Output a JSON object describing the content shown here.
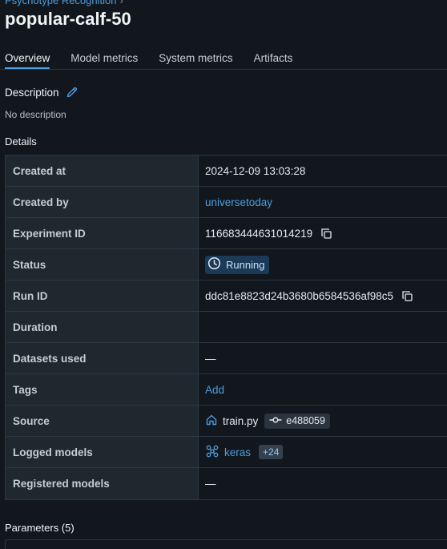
{
  "breadcrumb": {
    "experiment": "Psychotype Recognition",
    "chevron": "›"
  },
  "page_title": "popular-calf-50",
  "tabs": [
    {
      "label": "Overview",
      "active": true
    },
    {
      "label": "Model metrics",
      "active": false
    },
    {
      "label": "System metrics",
      "active": false
    },
    {
      "label": "Artifacts",
      "active": false
    }
  ],
  "description": {
    "label": "Description",
    "value": "No description",
    "edit_icon": "pencil-icon"
  },
  "details": {
    "label": "Details",
    "created_at": {
      "key": "Created at",
      "value": "2024-12-09 13:03:28"
    },
    "created_by": {
      "key": "Created by",
      "value": "universetoday"
    },
    "experiment_id": {
      "key": "Experiment ID",
      "value": "116683444631014219"
    },
    "status": {
      "key": "Status",
      "value": "Running",
      "icon": "clock-icon"
    },
    "run_id": {
      "key": "Run ID",
      "value": "ddc81e8823d24b3680b6584536af98c5"
    },
    "duration": {
      "key": "Duration",
      "value": ""
    },
    "datasets_used": {
      "key": "Datasets used",
      "value": "—"
    },
    "tags": {
      "key": "Tags",
      "value": "Add"
    },
    "source": {
      "key": "Source",
      "file": "train.py",
      "commit": "e488059",
      "icon": "home-icon"
    },
    "logged_models": {
      "key": "Logged models",
      "model": "keras",
      "extra_count": "+24",
      "icon": "models-icon"
    },
    "registered_models": {
      "key": "Registered models",
      "value": "—"
    }
  },
  "parameters": {
    "label": "Parameters (5)"
  },
  "colors": {
    "accent": "#4d9de0",
    "background": "#11171c",
    "key_cell": "#1f272f",
    "status_badge": "#1a3a57"
  }
}
